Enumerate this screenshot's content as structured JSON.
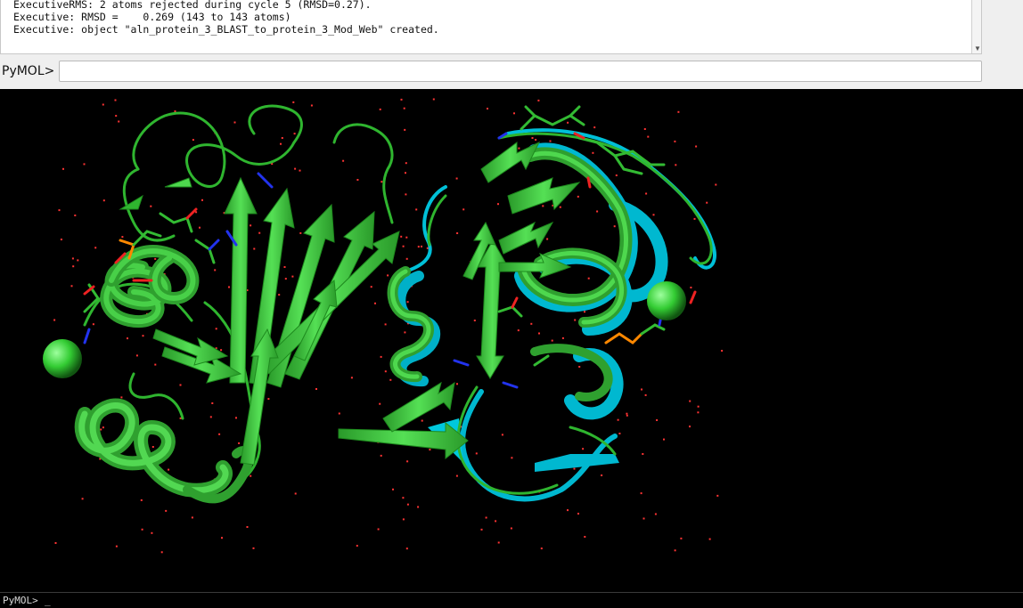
{
  "console": {
    "lines": [
      "ExecutiveRMS: 2 atoms rejected during cycle 5 (RMSD=0.27).",
      "Executive: RMSD =    0.269 (143 to 143 atoms)",
      "Executive: object \"aln_protein_3_BLAST_to_protein_3_Mod_Web\" created."
    ]
  },
  "command": {
    "label": "PyMOL>",
    "value": ""
  },
  "internal_prompt": {
    "label": "PyMOL>",
    "cursor": "_"
  },
  "colors": {
    "protein_green": "#33cc33",
    "protein_cyan": "#00c8dc",
    "water": "#ff3333",
    "background": "#000000",
    "carbon": "#33bb33",
    "nitrogen": "#2233ee",
    "oxygen": "#ee2222",
    "phosphorus": "#ff8800"
  }
}
